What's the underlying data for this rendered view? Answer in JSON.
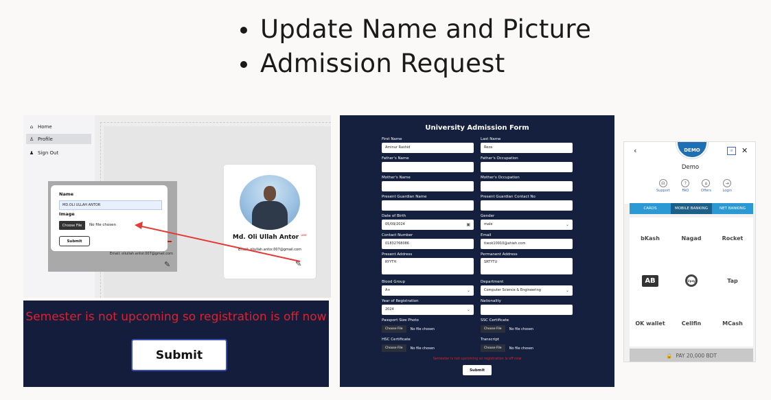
{
  "bullets": [
    "Update Name and Picture",
    "Admission Request"
  ],
  "profile_panel": {
    "sidebar": [
      {
        "label": "Home",
        "icon": "home-icon"
      },
      {
        "label": "Profile",
        "icon": "user-icon"
      },
      {
        "label": "Sign Out",
        "icon": "users-icon"
      }
    ],
    "card": {
      "name": "Md. Oli Ullah Antor",
      "role": "user",
      "email_prefix": "Email:",
      "email": "oliullah.antor.007@gmail.com"
    },
    "modal": {
      "name_label": "Name",
      "name_value": "MD.OLI ULLAH ANTOR",
      "image_label": "Image",
      "choose_file": "Choose File",
      "no_file": "No file chosen",
      "submit": "Submit",
      "behind_email_prefix": "Email:",
      "behind_email": "oliullah.antor.007@gmail.com"
    }
  },
  "registration_panel": {
    "message": "Semester is not upcoming so registration is off now",
    "submit": "Submit"
  },
  "admission_form": {
    "title": "University Admission Form",
    "left": [
      {
        "label": "First Name",
        "value": "Aminur Rashid"
      },
      {
        "label": "Father's Name",
        "value": ""
      },
      {
        "label": "Mother's Name",
        "value": ""
      },
      {
        "label": "Present Guardian Name",
        "value": ""
      },
      {
        "label": "Date of Birth",
        "value": "05/09/2024"
      },
      {
        "label": "Contact Number",
        "value": "01832768086"
      },
      {
        "label": "Present Address",
        "value": "RYYTH"
      },
      {
        "label": "Blood Group",
        "value": "A+"
      },
      {
        "label": "Year of Registration",
        "value": "2024"
      },
      {
        "label": "Passport Size Photo",
        "value": ""
      },
      {
        "label": "HSC Certificate",
        "value": ""
      }
    ],
    "right": [
      {
        "label": "Last Name",
        "value": "Reza"
      },
      {
        "label": "Father's Occupation",
        "value": ""
      },
      {
        "label": "Mother's Occupation",
        "value": ""
      },
      {
        "label": "Present Guardian Contact No",
        "value": ""
      },
      {
        "label": "Gender",
        "value": "male"
      },
      {
        "label": "Email",
        "value": "tiwok10910@ahieh.com"
      },
      {
        "label": "Permanent Address",
        "value": "SRTYTU"
      },
      {
        "label": "Department",
        "value": "Computer Science & Engineering"
      },
      {
        "label": "Nationality",
        "value": ""
      },
      {
        "label": "SSC Certificate",
        "value": ""
      },
      {
        "label": "Transcript",
        "value": ""
      }
    ],
    "choose_file": "Choose File",
    "no_file": "No file chosen",
    "error": "Semester is not upcoming so registration is off now",
    "submit": "Submit"
  },
  "payment": {
    "logo_text": "DEMO",
    "merchant": "Demo",
    "links": [
      {
        "label": "Support",
        "icon": "headset-icon"
      },
      {
        "label": "FAQ",
        "icon": "question-icon"
      },
      {
        "label": "Offers",
        "icon": "gift-icon"
      },
      {
        "label": "Login",
        "icon": "login-icon"
      }
    ],
    "tabs": [
      "CARDS",
      "MOBILE BANKING",
      "NET BANKING"
    ],
    "active_tab": "MOBILE BANKING",
    "methods": [
      "bKash",
      "Nagad",
      "Rocket",
      "AB",
      "Upay",
      "Tap",
      "OK wallet",
      "Cellfin",
      "MCash"
    ],
    "pay_button": "PAY 20,000 BDT"
  },
  "colors": {
    "form_bg": "#14203e",
    "error": "#e0202c",
    "tab_blue": "#2c98d4",
    "arrow": "#e53935"
  }
}
